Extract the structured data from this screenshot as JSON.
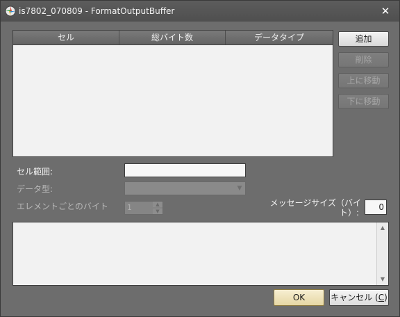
{
  "window": {
    "title": "is7802_070809 - FormatOutputBuffer",
    "close_glyph": "✕"
  },
  "table": {
    "columns": [
      "セル",
      "総バイト数",
      "データタイプ"
    ]
  },
  "side_buttons": {
    "add": "追加",
    "delete": "削除",
    "move_up": "上に移動",
    "move_down": "下に移動"
  },
  "form": {
    "cell_range_label": "セル範囲:",
    "cell_range_value": "",
    "data_type_label": "データ型:",
    "data_type_value": "",
    "bytes_per_element_label": "エレメントごとのバイト",
    "bytes_per_element_value": "1",
    "message_size_label_line1": "メッセージサイズ（バイ",
    "message_size_label_line2": "ト）:",
    "message_size_value": "0"
  },
  "footer": {
    "ok": "OK",
    "cancel_text": "キャンセル (",
    "cancel_mnemonic": "C",
    "cancel_close": ")"
  },
  "colors": {
    "background": "#6d6d6d",
    "ok_accent": "#e6d7a4"
  },
  "icons": {
    "app": "app-icon",
    "combo_arrow": "chevron-down-icon"
  }
}
